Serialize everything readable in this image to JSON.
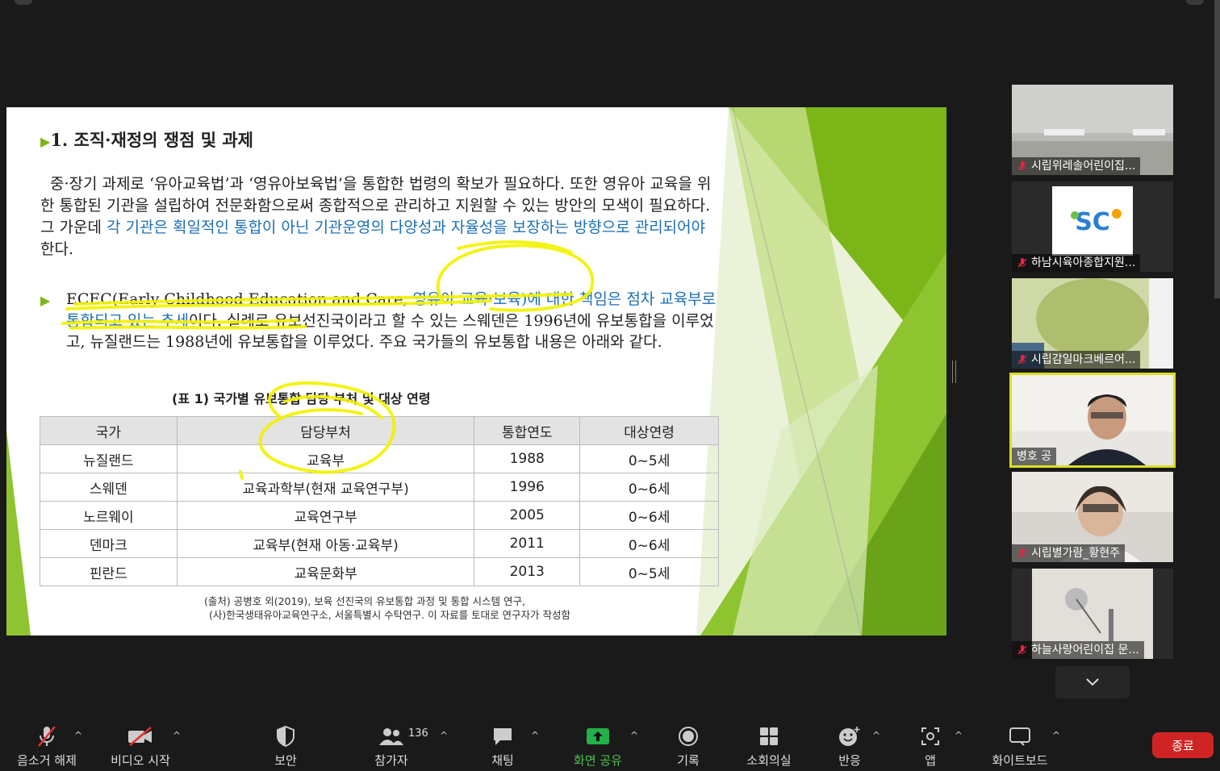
{
  "slide": {
    "title_marker": "▶",
    "title": "1. 조직·재정의 쟁점 및 과제",
    "para": {
      "text_a": "중·장기 과제로 ‘유아교육법’과 ‘영유아보육법’을 통합한 법령의 확보가 필요하다. 또한 영유아 교육을 위한 통합된 기관을 설립하여 전문화함으로써 종합적으로 관리하고 지원할 수 있는 방안의 모색이 필요하다. 그 가운데 ",
      "text_blue": "각 기관은 획일적인 통합이 아닌 기관운영의 다양성과 자율성을 보장하는 방향으로 관리되어야",
      "text_b": " 한다."
    },
    "bullet": {
      "marker": "▶",
      "text_a": "ECEC(Early Childhood Education and Care, ",
      "text_blue": "영유아 교육·보육)에 대한 책임은 점차 교육부로 통합되고 있는 추세",
      "text_b": "이다. 실례로 유보선진국이라고 할 수 있는 스웨덴은 1996년에 유보통합을 이루었고, 뉴질랜드는 1988년에 유보통합을 이루었다. 주요 국가들의 유보통합 내용은 아래와 같다."
    },
    "table_caption": "(표 1) 국가별 유보통합 담당 부처 및 대상 연령",
    "table": {
      "headers": [
        "국가",
        "담당부처",
        "통합연도",
        "대상연령"
      ],
      "rows": [
        [
          "뉴질랜드",
          "교육부",
          "1988",
          "0~5세"
        ],
        [
          "스웨덴",
          "교육과학부(현재 교육연구부)",
          "1996",
          "0~6세"
        ],
        [
          "노르웨이",
          "교육연구부",
          "2005",
          "0~6세"
        ],
        [
          "덴마크",
          "교육부(현재 아동·교육부)",
          "2011",
          "0~6세"
        ],
        [
          "핀란드",
          "교육문화부",
          "2013",
          "0~5세"
        ]
      ]
    },
    "source_line1": "(출처) 공병호 외(2019), 보육 선진국의 유보통합 과정 및 통합 시스템 연구,",
    "source_line2": "(사)한국생태유아교육연구소, 서울특별시 수탁연구. 이 자료를 토대로 연구자가 작성함"
  },
  "participants": [
    {
      "name": "시립위레솔어린이집...",
      "muted": true
    },
    {
      "name": "하남시육아종합지원...",
      "muted": true
    },
    {
      "name": "시립감일마크베르어...",
      "muted": true
    },
    {
      "name": "병호 공",
      "muted": false,
      "active": true
    },
    {
      "name": "시립별가람_황현주",
      "muted": true
    },
    {
      "name": "하늘사랑어린이집 문...",
      "muted": true
    }
  ],
  "toolbar": {
    "unmute": "음소거 해제",
    "start_video": "비디오 시작",
    "security": "보안",
    "participants": "참가자",
    "participants_count": "136",
    "chat": "채팅",
    "share_screen": "화면 공유",
    "record": "기록",
    "breakout": "소회의실",
    "reactions": "반응",
    "apps": "앱",
    "whiteboard": "화이트보드",
    "end": "종료",
    "caret": "^"
  },
  "colors": {
    "background": "#1a1a1a",
    "accent_green": "#7cb518",
    "highlight_yellow": "#f5f500",
    "share_green": "#4ec34e",
    "end_red": "#d02424",
    "slide_blue": "#1b6fb5"
  }
}
